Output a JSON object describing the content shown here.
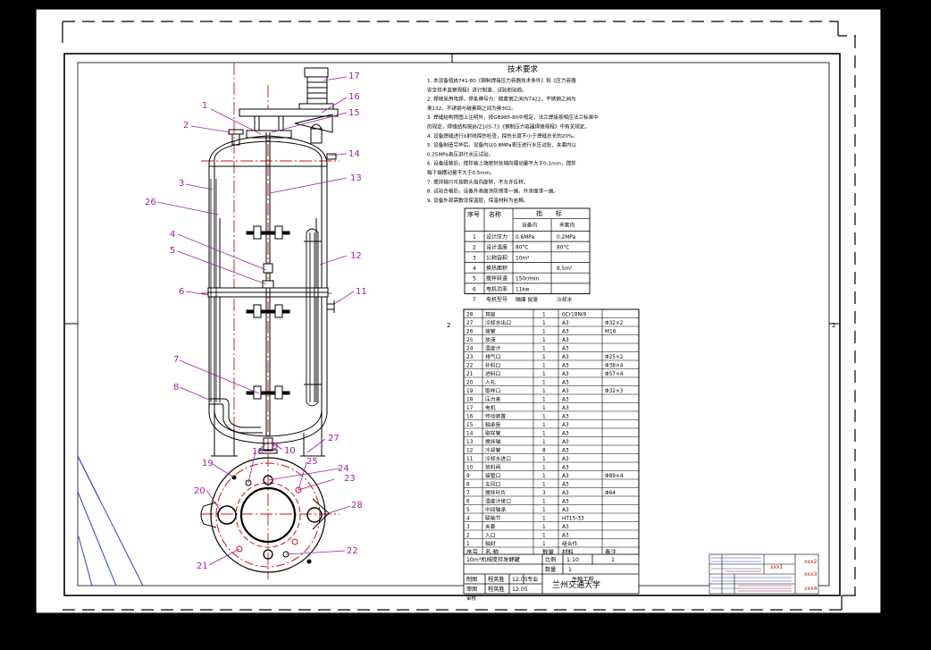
{
  "drawing": {
    "callouts": [
      "1",
      "2",
      "3",
      "4",
      "5",
      "6",
      "7",
      "8",
      "9",
      "10",
      "11",
      "12",
      "13",
      "14",
      "15",
      "16",
      "17",
      "18",
      "19",
      "20",
      "21",
      "22",
      "23",
      "24",
      "25",
      "26",
      "27",
      "28"
    ],
    "tech_title": "技术要求",
    "tech_lines": [
      "1. 本设备按JB741-80《钢制焊接压力容器技术条件》和《压力容器",
      "安全技术监察规程》进行制造、试验和验收。",
      "2. 焊接采用电焊，焊条牌号为：碳素钢之间为T422，不锈钢之间为",
      "奥132，不锈钢与碳素钢之间为奥302。",
      "3. 焊缝结构除图上注明外，按GB985-80中规定，法兰焊接按相应法兰标准中",
      "的规定，焊缝结构按JB/Z105-73《钢制压力容器焊接规程》中有关规定。",
      "4. 设备焊缝进行X射线探伤检查，探伤长度不小于焊缝总长的20%。",
      "5. 设备制造完毕后，设备内以0.8MPa表压进行水压试验，夹套内以",
      "0.25MPa表压进行水压试验。",
      "6. 设备组装后，搅拌轴上端密封处轴向摆动量不大于0.1mm，搅拌",
      "轴下端摆动量不大于0.5mm。",
      "7. 搅拌轴只可按箭头指向旋转，不允许反转。",
      "8. 试验合格后，设备外表面涂防锈漆一遍，外涂面漆一遍。",
      "9. 设备外部需敷设保温层，保温材料为岩棉。"
    ],
    "spec_table": {
      "head": [
        "序号",
        "名称",
        "指",
        "标"
      ],
      "sub": [
        "设备内",
        "夹套内"
      ],
      "rows": [
        [
          "1",
          "设计压力",
          "0.6MPa",
          "0.2MPa"
        ],
        [
          "2",
          "设计温度",
          "80°C",
          "80°C"
        ],
        [
          "3",
          "公称容积",
          "10m³",
          ""
        ],
        [
          "4",
          "换热面积",
          "",
          "8.5m²"
        ],
        [
          "5",
          "搅拌转速",
          "150r/min",
          ""
        ],
        [
          "6",
          "电机功率",
          "11kw",
          ""
        ],
        [
          "7",
          "电机型号",
          "隔爆 鼠笼",
          "冷却水"
        ]
      ]
    },
    "parts": [
      [
        "28",
        "耳座",
        "1",
        "0Cr18Ni9",
        ""
      ],
      [
        "27",
        "冷却水出口",
        "1",
        "A3",
        "Φ32×2"
      ],
      [
        "26",
        "接管",
        "1",
        "A3",
        "M16"
      ],
      [
        "25",
        "放液",
        "1",
        "A3",
        ""
      ],
      [
        "24",
        "温度计",
        "1",
        "A3",
        ""
      ],
      [
        "23",
        "排气口",
        "1",
        "A3",
        "Φ25×2"
      ],
      [
        "22",
        "补料口",
        "1",
        "A3",
        "Φ38×4"
      ],
      [
        "21",
        "进料口",
        "1",
        "A3",
        "Φ57×4"
      ],
      [
        "20",
        "人孔",
        "1",
        "A3",
        ""
      ],
      [
        "19",
        "取样口",
        "1",
        "A3",
        "Φ32×3"
      ],
      [
        "18",
        "压力表",
        "1",
        "A3",
        ""
      ],
      [
        "17",
        "电机",
        "1",
        "A3",
        ""
      ],
      [
        "16",
        "传动装置",
        "1",
        "A3",
        ""
      ],
      [
        "15",
        "轴承座",
        "1",
        "A3",
        ""
      ],
      [
        "14",
        "取样管",
        "1",
        "A3",
        ""
      ],
      [
        "13",
        "搅拌轴",
        "1",
        "A3",
        ""
      ],
      [
        "12",
        "冷却管",
        "8",
        "A3",
        ""
      ],
      [
        "11",
        "冷却水进口",
        "1",
        "A3",
        ""
      ],
      [
        "10",
        "放料阀",
        "1",
        "A3",
        ""
      ],
      [
        "9",
        "接管口",
        "1",
        "A3",
        "Φ89×4"
      ],
      [
        "8",
        "支风口",
        "1",
        "A3",
        ""
      ],
      [
        "7",
        "搅拌叶片",
        "3",
        "A3",
        "Φ64"
      ],
      [
        "6",
        "温度计接口",
        "1",
        "A3",
        ""
      ],
      [
        "5",
        "中间轴承",
        "1",
        "A3",
        ""
      ],
      [
        "4",
        "联轴节",
        "1",
        "HT15-33",
        ""
      ],
      [
        "3",
        "夹套",
        "1",
        "A3",
        ""
      ],
      [
        "2",
        "入口",
        "1",
        "A3",
        ""
      ],
      [
        "1",
        "轴封",
        "1",
        "组合件",
        ""
      ]
    ],
    "parts_header": [
      "序号",
      "名 称",
      "数量",
      "材料",
      "备注"
    ],
    "title_block": {
      "name": "10m³机械搅拌发酵罐",
      "ratio_label": "比例",
      "ratio": "1:10",
      "count_label": "数量",
      "count": "1",
      "sheet": "1",
      "material_label": "材料",
      "drawn_label": "制图",
      "checked_label": "审图",
      "review_label": "审核",
      "drawer": "程英胜",
      "checker": "程英胜",
      "date1": "12.05",
      "date2": "12.05",
      "major_label": "专业",
      "major": "生物工程",
      "school": "兰州交通大学"
    },
    "mini_block": [
      "xxx1",
      "xxx2",
      "xxx3",
      "xxx4"
    ],
    "center_marks": [
      "2",
      "2"
    ]
  }
}
